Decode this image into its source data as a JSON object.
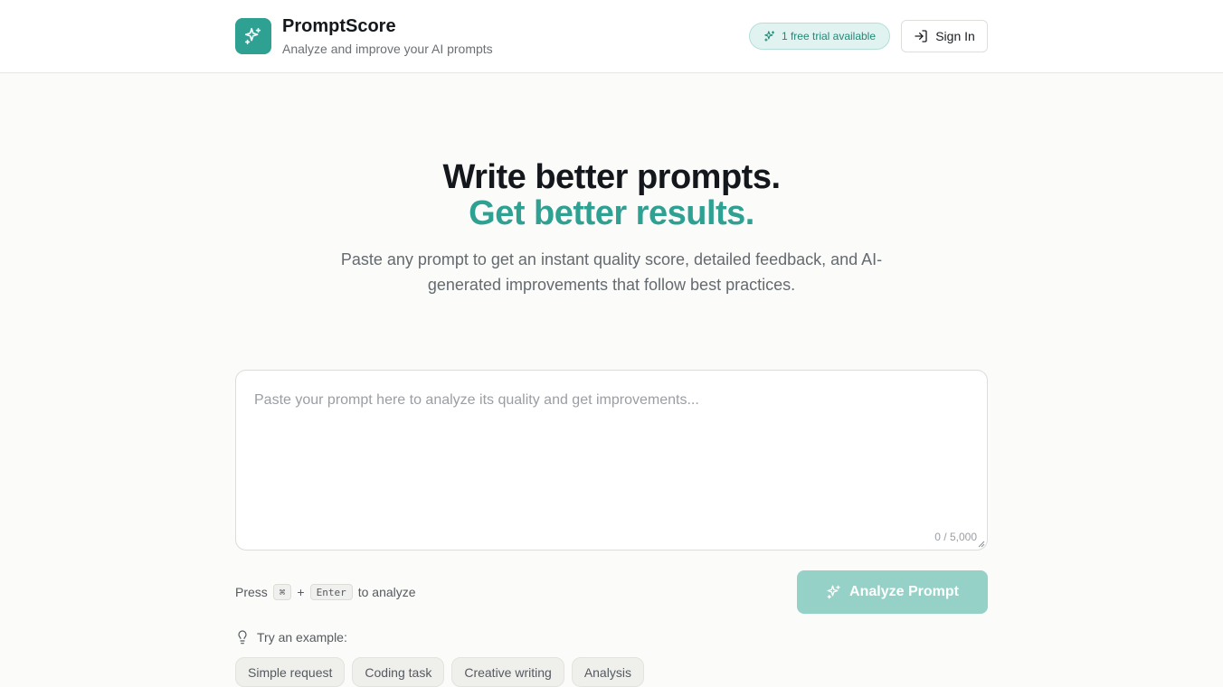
{
  "header": {
    "brand_name": "PromptScore",
    "tagline": "Analyze and improve your AI prompts",
    "trial_badge": "1 free trial available",
    "sign_in_label": "Sign In"
  },
  "hero": {
    "title_line1": "Write better prompts.",
    "title_line2": "Get better results.",
    "subtitle": "Paste any prompt to get an instant quality score, detailed feedback, and AI-generated improvements that follow best practices."
  },
  "prompt": {
    "value": "",
    "placeholder": "Paste your prompt here to analyze its quality and get improvements...",
    "char_count": "0 / 5,000"
  },
  "shortcut": {
    "press": "Press",
    "key1": "⌘",
    "plus": "+",
    "key2": "Enter",
    "suffix": "to analyze"
  },
  "analyze_button": {
    "label": "Analyze Prompt"
  },
  "examples": {
    "label": "Try an example:",
    "items": [
      "Simple request",
      "Coding task",
      "Creative writing",
      "Analysis"
    ]
  },
  "colors": {
    "accent": "#2fa193",
    "accent_disabled": "#96d1c8",
    "badge_bg": "#e1f3f0",
    "page_bg": "#fbfbf9"
  },
  "icons": {
    "logo": "sparkles-icon",
    "trial": "sparkles-icon",
    "sign_in": "log-in-icon",
    "analyze": "sparkles-icon",
    "examples": "lightbulb-icon"
  }
}
